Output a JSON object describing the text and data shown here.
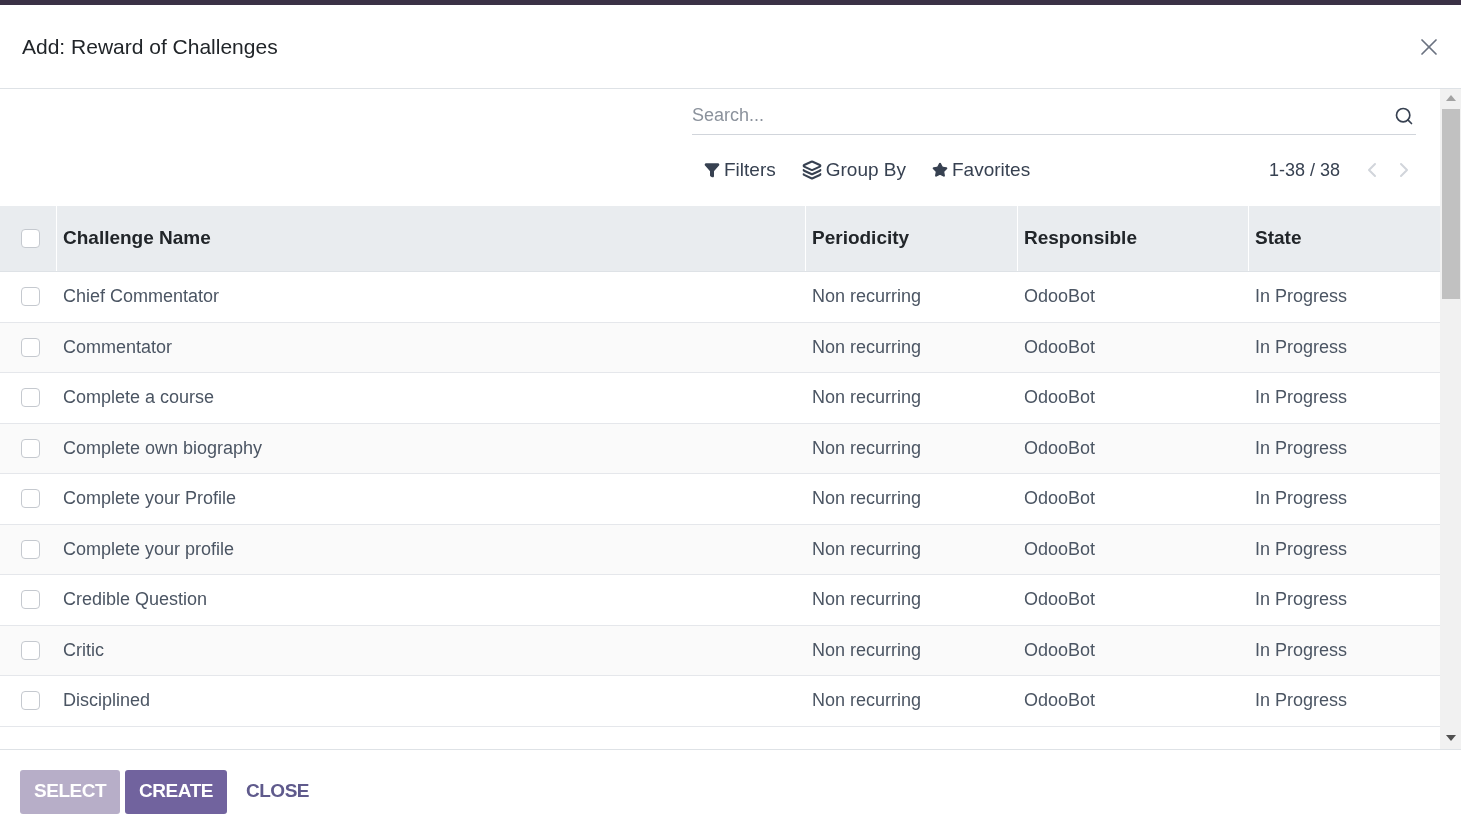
{
  "dialog": {
    "title": "Add: Reward of Challenges"
  },
  "search": {
    "placeholder": "Search..."
  },
  "toolbar": [
    {
      "kind": "filter",
      "label": "Filters"
    },
    {
      "kind": "group",
      "label": "Group By"
    },
    {
      "kind": "star",
      "label": "Favorites"
    }
  ],
  "pager": {
    "range": "1-38 / 38"
  },
  "table": {
    "select_all": {
      "checked": false
    },
    "columns": [
      "Challenge Name",
      "Periodicity",
      "Responsible",
      "State"
    ],
    "rows": [
      {
        "checked": false,
        "cells": [
          "Chief Commentator",
          "Non recurring",
          "OdooBot",
          "In Progress"
        ]
      },
      {
        "checked": false,
        "cells": [
          "Commentator",
          "Non recurring",
          "OdooBot",
          "In Progress"
        ]
      },
      {
        "checked": false,
        "cells": [
          "Complete a course",
          "Non recurring",
          "OdooBot",
          "In Progress"
        ]
      },
      {
        "checked": false,
        "cells": [
          "Complete own biography",
          "Non recurring",
          "OdooBot",
          "In Progress"
        ]
      },
      {
        "checked": false,
        "cells": [
          "Complete your Profile",
          "Non recurring",
          "OdooBot",
          "In Progress"
        ]
      },
      {
        "checked": false,
        "cells": [
          "Complete your profile",
          "Non recurring",
          "OdooBot",
          "In Progress"
        ]
      },
      {
        "checked": false,
        "cells": [
          "Credible Question",
          "Non recurring",
          "OdooBot",
          "In Progress"
        ]
      },
      {
        "checked": false,
        "cells": [
          "Critic",
          "Non recurring",
          "OdooBot",
          "In Progress"
        ]
      },
      {
        "checked": false,
        "cells": [
          "Disciplined",
          "Non recurring",
          "OdooBot",
          "In Progress"
        ]
      }
    ]
  },
  "footer": [
    {
      "label": "SELECT",
      "kind": "primary",
      "disabled": true
    },
    {
      "label": "CREATE",
      "kind": "primary",
      "disabled": false
    },
    {
      "label": "CLOSE",
      "kind": "link",
      "disabled": false
    }
  ]
}
